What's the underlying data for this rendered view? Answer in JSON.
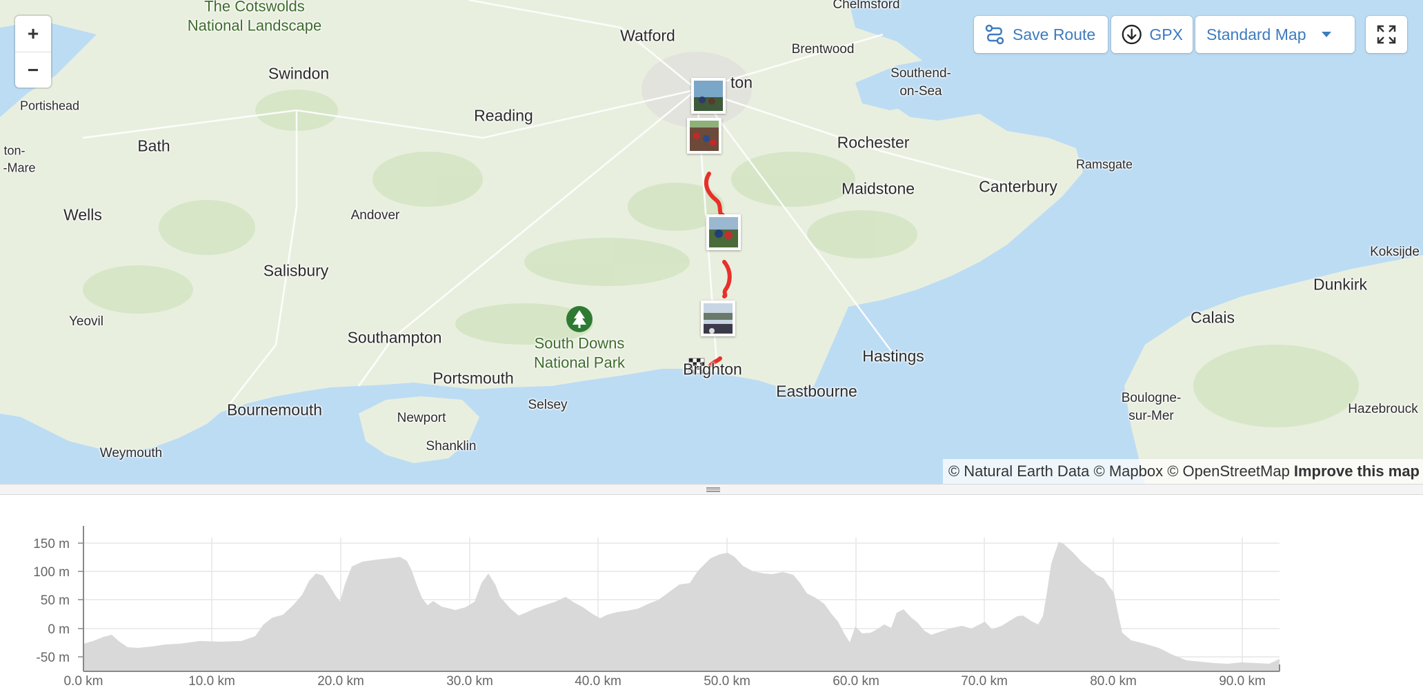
{
  "map": {
    "controls": {
      "zoom_in": "+",
      "zoom_out": "−",
      "fullscreen_icon": "fullscreen-icon"
    },
    "toolbar": {
      "save_route": "Save Route",
      "gpx": "GPX",
      "map_style": "Standard Map"
    },
    "attribution": {
      "text": "© Natural Earth Data © Mapbox © OpenStreetMap",
      "improve": "Improve this map"
    },
    "places": {
      "cotswolds": "The Cotswolds",
      "cotswolds2": "National Landscape",
      "chelmsford": "Chelmsford",
      "watford": "Watford",
      "brentwood": "Brentwood",
      "southend": "Southend-",
      "southend2": "on-Sea",
      "swindon": "Swindon",
      "portishead": "Portishead",
      "london": "ton",
      "reading": "Reading",
      "bath": "Bath",
      "weston": "ton-",
      "weston2": "-Mare",
      "rochester": "Rochester",
      "ramsgate": "Ramsgate",
      "canterbury": "Canterbury",
      "maidstone": "Maidstone",
      "wells": "Wells",
      "andover": "Andover",
      "salisbury": "Salisbury",
      "koksijde": "Koksijde",
      "dunkirk": "Dunkirk",
      "calais": "Calais",
      "yeovil": "Yeovil",
      "southampton": "Southampton",
      "south_downs": "South Downs",
      "south_downs2": "National Park",
      "hastings": "Hastings",
      "portsmouth": "Portsmouth",
      "brighton": "Brighton",
      "eastbourne": "Eastbourne",
      "selsey": "Selsey",
      "boulogne": "Boulogne-",
      "boulogne2": "sur-Mer",
      "bournemouth": "Bournemouth",
      "hazebrouck": "Hazebrouck",
      "newport": "Newport",
      "shanklin": "Shanklin",
      "weymouth": "Weymouth"
    },
    "route_color": "#e8302a",
    "water_color": "#bcdcf4",
    "land_color": "#e9efdf"
  },
  "profile": {
    "y_ticks": [
      "150 m",
      "100 m",
      "50 m",
      "0 m",
      "-50 m"
    ],
    "x_ticks": [
      "0.0 km",
      "10.0 km",
      "20.0 km",
      "30.0 km",
      "40.0 km",
      "50.0 km",
      "60.0 km",
      "70.0 km",
      "80.0 km",
      "90.0 km"
    ],
    "fill_color": "#d9d9d9"
  }
}
